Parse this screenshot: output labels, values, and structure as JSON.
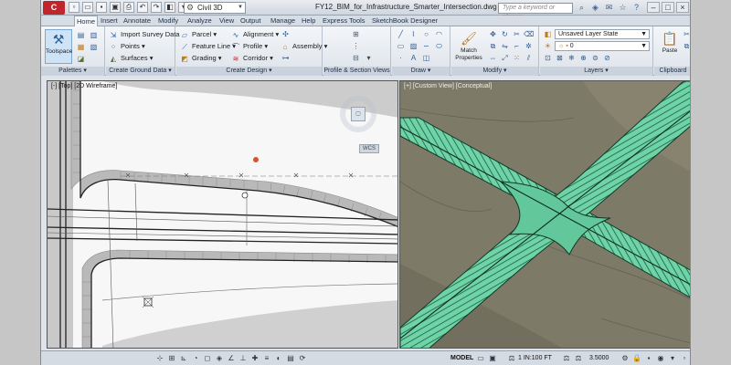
{
  "titlebar": {
    "app_logo": "C",
    "workspace": "Civil 3D",
    "document_title": "FY12_BIM_for_Infrastructure_Smarter_Intersection.dwg",
    "search_placeholder": "Type a keyword or phrase"
  },
  "tabs": [
    "Home",
    "Insert",
    "Annotate",
    "Modify",
    "Analyze",
    "View",
    "Output",
    "Manage",
    "Help",
    "Express Tools",
    "SketchBook Designer"
  ],
  "ribbon": {
    "palettes": {
      "title": "Palettes",
      "toolspace_label": "Toolspace"
    },
    "ground": {
      "title": "Create Ground Data",
      "items": [
        "Import Survey Data",
        "Points",
        "Surfaces"
      ]
    },
    "design": {
      "title": "Create Design",
      "col1": [
        "Parcel",
        "Feature Line",
        "Grading"
      ],
      "col2": [
        "Alignment",
        "Profile",
        "Corridor"
      ],
      "col3": [
        "",
        "Assembly",
        ""
      ]
    },
    "profile": {
      "title": "Profile & Section Views"
    },
    "draw": {
      "title": "Draw"
    },
    "modify": {
      "title": "Modify",
      "match_label": "Match Properties"
    },
    "layers": {
      "title": "Layers",
      "layer_state": "Unsaved Layer State",
      "current_layer": "0"
    },
    "clipboard": {
      "title": "Clipboard",
      "paste_label": "Paste"
    }
  },
  "viewports": {
    "left_label": "[-] [Top] [2D Wireframe]",
    "right_label": "[+] [Custom View] [Conceptual]",
    "wcs": "WCS",
    "right_controls": "◦ □ ×"
  },
  "statusbar": {
    "model": "MODEL",
    "scale": "1 IN:100 FT",
    "elevation": "3.5000"
  },
  "colors": {
    "road_green": "#6fd3a8",
    "terrain": "#7d7a68",
    "ribbon_bg": "#f4f6f9",
    "logo_red": "#c0272d"
  }
}
